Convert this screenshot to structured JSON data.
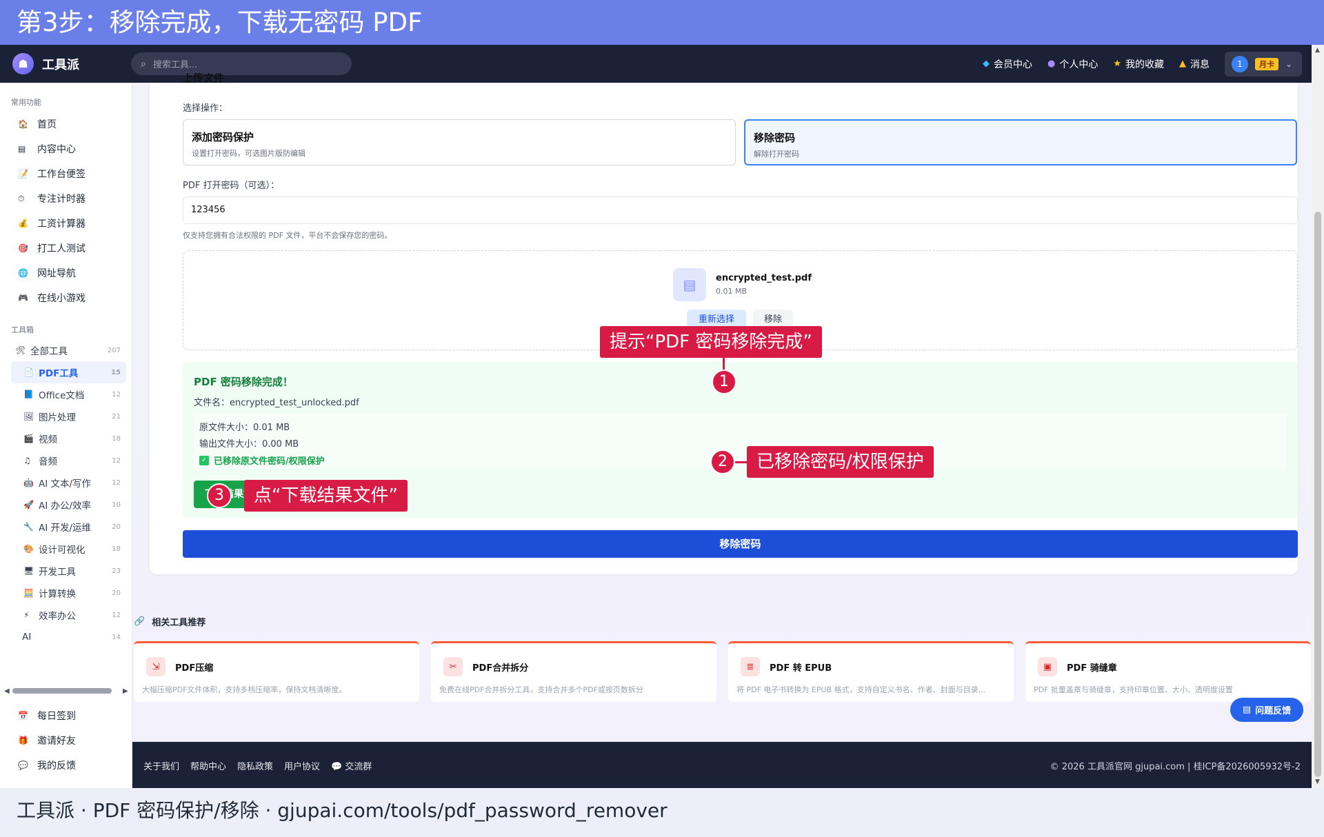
{
  "banner": {
    "title": "第3步：移除完成，下载无密码 PDF"
  },
  "header": {
    "logo_icon": "bag-icon",
    "logo_text": "工具派",
    "search_placeholder": "搜索工具...",
    "nav": [
      {
        "label": "会员中心",
        "icon": "diamond-icon"
      },
      {
        "label": "个人中心",
        "icon": "user-icon"
      },
      {
        "label": "我的收藏",
        "icon": "star-icon"
      },
      {
        "label": "消息",
        "icon": "bell-icon"
      }
    ],
    "user_avatar": "1",
    "user_badge": "月卡"
  },
  "sidebar": {
    "common_caption": "常用功能",
    "common": [
      {
        "label": "首页",
        "icon": "home-icon"
      },
      {
        "label": "内容中心",
        "icon": "document-icon"
      },
      {
        "label": "工作台便签",
        "icon": "note-icon"
      },
      {
        "label": "专注计时器",
        "icon": "timer-icon"
      },
      {
        "label": "工资计算器",
        "icon": "money-bag-icon"
      },
      {
        "label": "打工人测试",
        "icon": "target-icon"
      },
      {
        "label": "网址导航",
        "icon": "globe-icon"
      },
      {
        "label": "在线小游戏",
        "icon": "gamepad-icon"
      }
    ],
    "tools_caption": "工具箱",
    "tools": [
      {
        "label": "全部工具",
        "count": "207",
        "icon": "tools-icon"
      },
      {
        "label": "PDF工具",
        "count": "15",
        "icon": "pdf-icon"
      },
      {
        "label": "Office文档",
        "count": "12",
        "icon": "book-icon"
      },
      {
        "label": "图片处理",
        "count": "21",
        "icon": "image-icon"
      },
      {
        "label": "视频",
        "count": "18",
        "icon": "clapper-icon"
      },
      {
        "label": "音频",
        "count": "12",
        "icon": "music-icon"
      },
      {
        "label": "AI 文本/写作",
        "count": "12",
        "icon": "robot-icon"
      },
      {
        "label": "AI 办公/效率",
        "count": "10",
        "icon": "rocket-icon"
      },
      {
        "label": "AI 开发/运维",
        "count": "20",
        "icon": "wrench-icon"
      },
      {
        "label": "设计可视化",
        "count": "18",
        "icon": "palette-icon"
      },
      {
        "label": "开发工具",
        "count": "23",
        "icon": "monitor-icon"
      },
      {
        "label": "计算转换",
        "count": "20",
        "icon": "calculator-icon"
      },
      {
        "label": "效率办公",
        "count": "12",
        "icon": "lightning-icon"
      },
      {
        "label": "AI",
        "count": "14",
        "icon": ""
      }
    ],
    "bottom": [
      {
        "label": "每日签到",
        "icon": "calendar-icon"
      },
      {
        "label": "邀请好友",
        "icon": "gift-icon"
      },
      {
        "label": "我的反馈",
        "icon": "chat-icon"
      }
    ]
  },
  "form": {
    "cut_title": "上传文件",
    "select_label": "选择操作：",
    "options": [
      {
        "title": "添加密码保护",
        "desc": "设置打开密码，可选图片版防编辑"
      },
      {
        "title": "移除密码",
        "desc": "解除打开密码"
      }
    ],
    "pwd_label": "PDF 打开密码（可选）：",
    "pwd_value": "123456",
    "note": "仅支持您拥有合法权限的 PDF 文件，平台不会保存您的密码。",
    "file_name": "encrypted_test.pdf",
    "file_size": "0.01 MB",
    "reselect": "重新选择",
    "remove": "移除",
    "submit": "移除密码"
  },
  "result": {
    "title": "PDF 密码移除完成！",
    "file_line": "文件名：encrypted_test_unlocked.pdf",
    "orig_size": "原文件大小：0.01 MB",
    "out_size": "输出文件大小：0.00 MB",
    "ok_text": "已移除原文件密码/权限保护",
    "download": "下载结果文件"
  },
  "related": {
    "title": "相关工具推荐",
    "items": [
      {
        "title": "PDF压缩",
        "desc": "大幅压缩PDF文件体积，支持多档压缩率，保持文档清晰度。",
        "icon": "compress-icon"
      },
      {
        "title": "PDF合并拆分",
        "desc": "免费在线PDF合并拆分工具，支持合并多个PDF或按页数拆分",
        "icon": "scissors-icon"
      },
      {
        "title": "PDF 转 EPUB",
        "desc": "将 PDF 电子书转换为 EPUB 格式，支持自定义书名、作者、封面与目录...",
        "icon": "epub-icon"
      },
      {
        "title": "PDF 骑缝章",
        "desc": "PDF 批量盖章与骑缝章，支持印章位置、大小、透明度设置",
        "icon": "stamp-icon"
      }
    ]
  },
  "footer": {
    "links": [
      "关于我们",
      "帮助中心",
      "隐私政策",
      "用户协议",
      "💬 交流群"
    ],
    "copyright": "© 2026 工具派官网 gjupai.com | 桂ICP备2026005932号-2"
  },
  "feedback_button": "问题反馈",
  "caption": "工具派 · PDF 密码保护/移除 · gjupai.com/tools/pdf_password_remover",
  "annotations": [
    {
      "num": "1",
      "text": "提示“PDF 密码移除完成”"
    },
    {
      "num": "2",
      "text": "已移除密码/权限保护"
    },
    {
      "num": "3",
      "text": "点“下载结果文件”"
    }
  ],
  "colors": {
    "accent": "#1d4ed8",
    "success": "#16a34a",
    "callout": "#d81b45",
    "nav_bg": "#1b2136"
  }
}
